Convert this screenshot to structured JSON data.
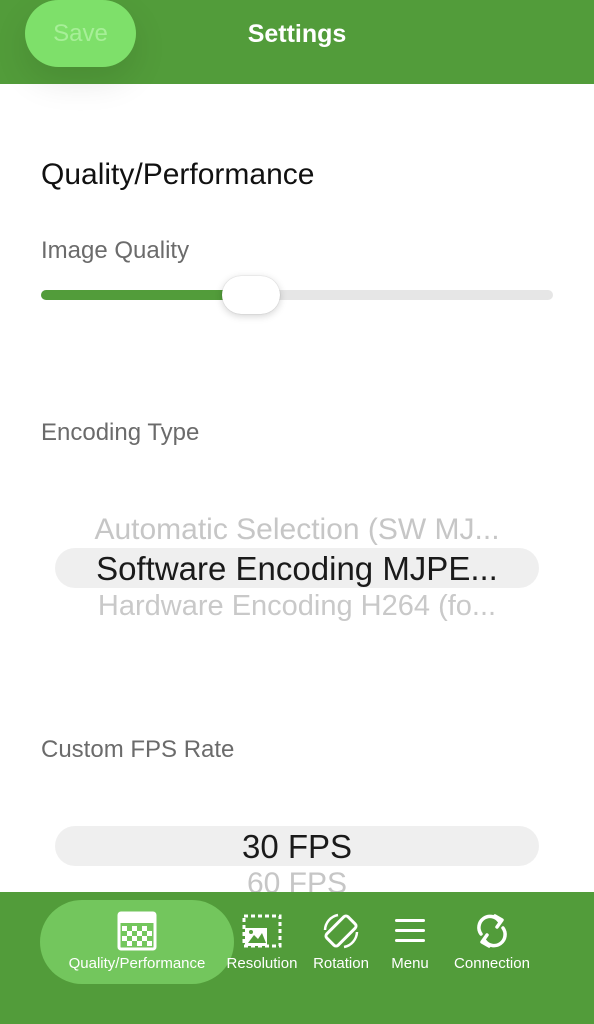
{
  "header": {
    "save_label": "Save",
    "title": "Settings"
  },
  "quality": {
    "section_title": "Quality/Performance",
    "image_quality_label": "Image Quality",
    "image_quality_value": 0.41
  },
  "encoding": {
    "label": "Encoding Type",
    "options": [
      "Automatic Selection (SW MJ...",
      "Software Encoding MJPE...",
      "Hardware Encoding H264 (fo..."
    ],
    "selected_index": 1
  },
  "fps": {
    "label": "Custom FPS Rate",
    "options": [
      "30 FPS",
      "60 FPS"
    ],
    "selected_index": 0
  },
  "tabbar": {
    "active_color": "#73c65d",
    "bar_color": "#529c3a",
    "tabs": [
      {
        "label": "Quality/Performance",
        "icon": "checkerboard-icon"
      },
      {
        "label": "Resolution",
        "icon": "image-frame-icon"
      },
      {
        "label": "Rotation",
        "icon": "rotate-device-icon"
      },
      {
        "label": "Menu",
        "icon": "hamburger-icon"
      },
      {
        "label": "Connection",
        "icon": "refresh-icon"
      }
    ],
    "active_index": 0
  }
}
